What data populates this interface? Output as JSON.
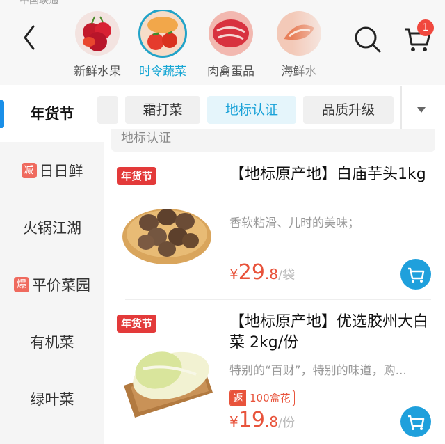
{
  "status_bar": {
    "carrier": "中国联通"
  },
  "header": {
    "categories": [
      {
        "label": "新鲜水果",
        "active": false
      },
      {
        "label": "时令蔬菜",
        "active": true
      },
      {
        "label": "肉禽蛋品",
        "active": false
      },
      {
        "label": "海鲜水",
        "active": false
      }
    ],
    "cart_badge": "1",
    "icons": {
      "back": "back-arrow-icon",
      "search": "search-icon",
      "cart": "cart-icon"
    }
  },
  "sidebar": {
    "items": [
      {
        "label": "年货节",
        "active": true,
        "tag": ""
      },
      {
        "label": "日日鲜",
        "active": false,
        "tag": "减"
      },
      {
        "label": "火锅江湖",
        "active": false,
        "tag": ""
      },
      {
        "label": "平价菜园",
        "active": false,
        "tag": "爆"
      },
      {
        "label": "有机菜",
        "active": false,
        "tag": ""
      },
      {
        "label": "绿叶菜",
        "active": false,
        "tag": ""
      }
    ]
  },
  "filters": {
    "chips": [
      {
        "label": "霜打菜",
        "active": false
      },
      {
        "label": "地标认证",
        "active": true
      },
      {
        "label": "品质升级",
        "active": false
      }
    ]
  },
  "section_title": "地标认证",
  "products": [
    {
      "promo_tag": "年货节",
      "title": "【地标原产地】白庙芋头1kg",
      "desc": "香软粘滑、儿时的美味；",
      "currency": "¥",
      "price_int": "29",
      "price_dec": ".8",
      "unit": "/袋",
      "rebate_label": "",
      "rebate_value": ""
    },
    {
      "promo_tag": "年货节",
      "title": "【地标原产地】优选胶州大白菜 2kg/份",
      "desc": "特别的“百财”，特别的味道，购...",
      "currency": "¥",
      "price_int": "19",
      "price_dec": ".8",
      "unit": "/份",
      "rebate_label": "返",
      "rebate_value": "100盒花"
    }
  ],
  "colors": {
    "accent": "#1aa2d8",
    "price": "#e8533b",
    "promo": "#e33a3a",
    "badge": "#f0483e"
  }
}
